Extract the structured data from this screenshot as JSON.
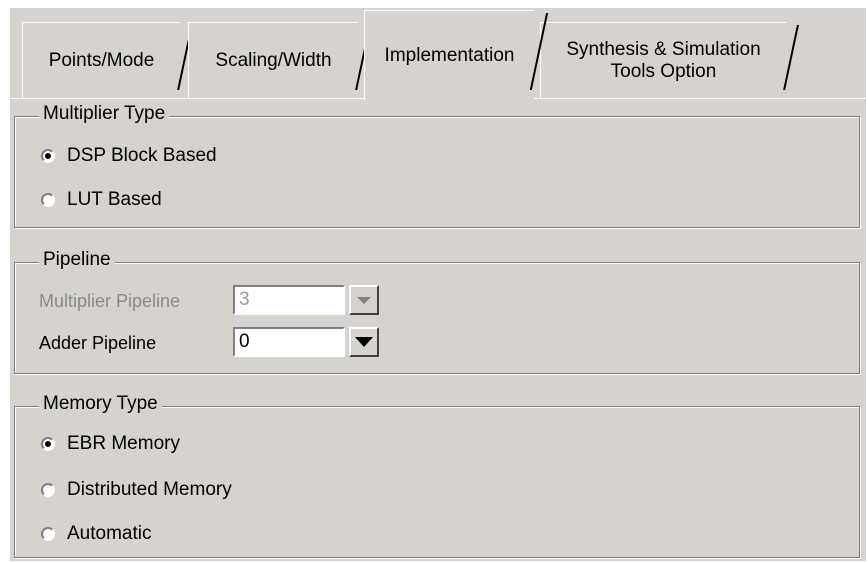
{
  "tabs": [
    {
      "label": "Points/Mode",
      "active": false
    },
    {
      "label": "Scaling/Width",
      "active": false
    },
    {
      "label": "Implementation",
      "active": true
    },
    {
      "label": "Synthesis & Simulation\nTools Option",
      "active": false
    }
  ],
  "multiplier_type": {
    "legend": "Multiplier Type",
    "options": [
      {
        "label": "DSP Block Based",
        "selected": true
      },
      {
        "label": "LUT Based",
        "selected": false
      }
    ]
  },
  "pipeline": {
    "legend": "Pipeline",
    "multiplier_label": "Multiplier Pipeline",
    "multiplier_value": "3",
    "multiplier_enabled": false,
    "adder_label": "Adder Pipeline",
    "adder_value": "0",
    "adder_enabled": true
  },
  "memory_type": {
    "legend": "Memory Type",
    "options": [
      {
        "label": "EBR Memory",
        "selected": true
      },
      {
        "label": "Distributed Memory",
        "selected": false
      },
      {
        "label": "Automatic",
        "selected": false
      }
    ]
  },
  "colors": {
    "background": "#d6d3ce",
    "disabled_text": "#8a8a8a"
  }
}
